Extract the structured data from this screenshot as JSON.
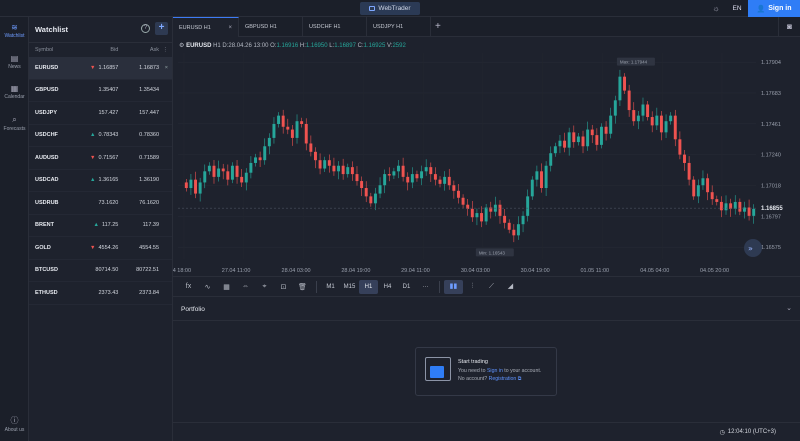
{
  "topbar": {
    "brand": "WebTrader",
    "lang": "EN",
    "signin": "Sign in",
    "icons": [
      "theme-icon",
      "user-icon"
    ]
  },
  "nav": [
    {
      "label": "Watchlist",
      "icon": "list-icon",
      "active": true
    },
    {
      "label": "News",
      "icon": "news-icon"
    },
    {
      "label": "Calendar",
      "icon": "calendar-icon"
    },
    {
      "label": "Forecasts",
      "icon": "forecast-icon"
    },
    {
      "label": "About us",
      "icon": "info-icon"
    }
  ],
  "watchlist": {
    "title": "Watchlist",
    "help": "?",
    "add": "+",
    "columns": {
      "symbol": "Symbol",
      "bid": "Bid",
      "ask": "Ask"
    },
    "rows": [
      {
        "symbol": "EURUSD",
        "bid": "1.16857",
        "ask": "1.16873",
        "dir": "down",
        "selected": true
      },
      {
        "symbol": "GBPUSD",
        "bid": "1.35407",
        "ask": "1.35434",
        "dir": ""
      },
      {
        "symbol": "USDJPY",
        "bid": "157.427",
        "ask": "157.447",
        "dir": ""
      },
      {
        "symbol": "USDCHF",
        "bid": "0.78343",
        "ask": "0.78360",
        "dir": "up"
      },
      {
        "symbol": "AUDUSD",
        "bid": "0.71567",
        "ask": "0.71589",
        "dir": "down"
      },
      {
        "symbol": "USDCAD",
        "bid": "1.36165",
        "ask": "1.36190",
        "dir": "up"
      },
      {
        "symbol": "USDRUB",
        "bid": "73.1620",
        "ask": "76.1620",
        "dir": ""
      },
      {
        "symbol": "BRENT",
        "bid": "117.25",
        "ask": "117.39",
        "dir": "up"
      },
      {
        "symbol": "GOLD",
        "bid": "4554.26",
        "ask": "4554.55",
        "dir": "down"
      },
      {
        "symbol": "BTCUSD",
        "bid": "80714.50",
        "ask": "80722.51",
        "dir": ""
      },
      {
        "symbol": "ETHUSD",
        "bid": "2373.43",
        "ask": "2373.84",
        "dir": ""
      }
    ]
  },
  "tabs": [
    {
      "label": "EURUSD H1",
      "active": true,
      "close": "×"
    },
    {
      "label": "GBPUSD H1"
    },
    {
      "label": "USDCHF H1"
    },
    {
      "label": "USDJPY H1"
    }
  ],
  "tab_add": "+",
  "ohlc": {
    "symbol": "EURUSD",
    "tf": "H1",
    "date_label": "D:",
    "date": "28.04.26 13:00",
    "o_label": "O:",
    "o": "1.16916",
    "h_label": "H:",
    "h": "1.16950",
    "l_label": "L:",
    "l": "1.16897",
    "c_label": "C:",
    "c": "1.16925",
    "v_label": "V:",
    "v": "2592"
  },
  "chart_data": {
    "type": "candlestick",
    "y_ticks": [
      "1.17904",
      "1.17683",
      "1.17461",
      "1.17240",
      "1.17018",
      "1.16797",
      "1.16575"
    ],
    "ylim": [
      1.1649,
      1.1797
    ],
    "x_ticks": [
      "24.04 18:00",
      "27.04 11:00",
      "28.04 03:00",
      "28.04 19:00",
      "29.04 11:00",
      "30.04 03:00",
      "30.04 19:00",
      "01.05 11:00",
      "04.05 04:00",
      "04.05 20:00"
    ],
    "last_price": "1.16855",
    "last_price_value": 1.16855,
    "max_label": "Max: 1.17944",
    "min_label": "Min: 1.16543",
    "close": [
      1.17,
      1.1706,
      1.1696,
      1.1704,
      1.1712,
      1.1716,
      1.1708,
      1.1714,
      1.1712,
      1.1706,
      1.1716,
      1.1708,
      1.1704,
      1.1711,
      1.1718,
      1.1722,
      1.172,
      1.173,
      1.1736,
      1.1746,
      1.1752,
      1.1744,
      1.1742,
      1.1736,
      1.1748,
      1.1746,
      1.1732,
      1.1726,
      1.172,
      1.1714,
      1.172,
      1.1716,
      1.1712,
      1.1716,
      1.171,
      1.1715,
      1.171,
      1.1705,
      1.17,
      1.1694,
      1.1689,
      1.1696,
      1.1702,
      1.171,
      1.1709,
      1.1712,
      1.1716,
      1.1708,
      1.1704,
      1.171,
      1.1707,
      1.1712,
      1.1715,
      1.171,
      1.1706,
      1.1703,
      1.1708,
      1.1702,
      1.1698,
      1.1693,
      1.1688,
      1.1685,
      1.1679,
      1.1682,
      1.1676,
      1.1686,
      1.1683,
      1.1688,
      1.168,
      1.1675,
      1.167,
      1.1666,
      1.1674,
      1.168,
      1.1694,
      1.1706,
      1.1712,
      1.17,
      1.1716,
      1.1725,
      1.173,
      1.1734,
      1.1729,
      1.174,
      1.1733,
      1.1737,
      1.173,
      1.1742,
      1.1738,
      1.1731,
      1.1744,
      1.1739,
      1.1752,
      1.1763,
      1.178,
      1.177,
      1.1756,
      1.1748,
      1.1752,
      1.176,
      1.1751,
      1.1745,
      1.1752,
      1.174,
      1.1748,
      1.1752,
      1.1735,
      1.1724,
      1.1718,
      1.1706,
      1.1694,
      1.1702,
      1.1707,
      1.1697,
      1.1692,
      1.169,
      1.1684,
      1.1689,
      1.1685,
      1.169,
      1.1683,
      1.1686,
      1.168,
      1.1685
    ]
  },
  "toolbar": {
    "timeframes": [
      "M1",
      "M15",
      "H1",
      "H4",
      "D1"
    ],
    "active_tf": "H1",
    "more": "···",
    "tool_icons": [
      "indicators-icon",
      "draw-icon",
      "calendar-tool-icon",
      "measure-icon",
      "shapes-icon",
      "crop-icon",
      "delete-icon"
    ],
    "tool_glyphs": [
      "fx",
      "∿",
      "▦",
      "⇔",
      "⌖",
      "⊡",
      "🗑"
    ],
    "chart_types": [
      "candles-icon",
      "bars-icon",
      "line-icon",
      "area-icon"
    ],
    "chart_type_glyphs": [
      "▮▮",
      "⫶",
      "⟋",
      "◢"
    ]
  },
  "portfolio": {
    "title": "Portfolio",
    "card_title": "Start trading",
    "need_pre": "You need to",
    "need_link": "Sign in",
    "need_post": "to your account.",
    "noacc": "No account?",
    "reg_link": "Registration",
    "ext": "⧉"
  },
  "status": {
    "time": "12:04:10 (UTC+3)"
  }
}
